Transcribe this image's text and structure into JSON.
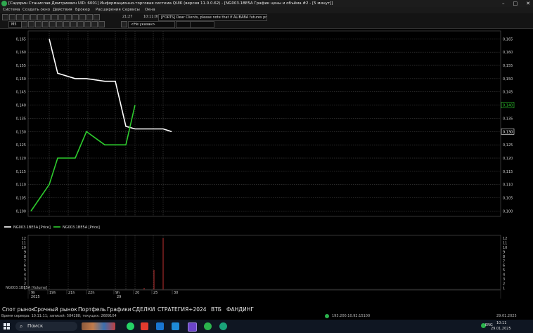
{
  "window": {
    "title": "[Садорин Станислав Дмитриевич UID: 6001] Информационно-торговая система QUIK (версия 11.0.0.62) - [NG003.1BE5A График цены и объёма #2 - [5 минут]]"
  },
  "menu": [
    "Система",
    "Создать окно",
    "Действия",
    "Брокер",
    "Расширения",
    "Сервисы",
    "Окна"
  ],
  "toolbar": {
    "interval": "М5",
    "time_a": "21:27",
    "time_b": "10:11:00",
    "news": "[FORTS] Dear Clients, please note that if ALIBABA futures price...",
    "account": "<Не указан>"
  },
  "chart_data": [
    {
      "type": "line",
      "x": [
        "18h",
        "19h",
        "20h",
        "21h",
        "22h",
        "23h",
        "9h",
        "10h",
        "20",
        "25",
        "30"
      ],
      "series": [
        {
          "name": "NG003.1BE5A [Price]",
          "color": "#ffffff",
          "values": [
            null,
            0.165,
            0.152,
            0.15,
            0.15,
            0.149,
            0.149,
            0.132,
            0.131,
            0.131,
            0.13
          ]
        },
        {
          "name": "NG003.1BE5A [Price]",
          "color": "#2ecc2e",
          "values": [
            0.1,
            0.11,
            0.12,
            0.12,
            0.13,
            0.125,
            0.125,
            0.125,
            0.14,
            null,
            null
          ]
        }
      ],
      "ylim": [
        0.098,
        0.168
      ],
      "yticks": [
        0.1,
        0.105,
        0.11,
        0.115,
        0.12,
        0.125,
        0.13,
        0.135,
        0.14,
        0.145,
        0.15,
        0.155,
        0.16,
        0.165
      ],
      "ytick_labels": [
        "0,100",
        "0,105",
        "0,110",
        "0,115",
        "0,120",
        "0,125",
        "0,130",
        "0,135",
        "0,140",
        "0,145",
        "0,150",
        "0,155",
        "0,160",
        "0,165"
      ],
      "last_values": [
        {
          "label": "0,130",
          "value": 0.13,
          "color": "#ffffff"
        },
        {
          "label": "0,140",
          "value": 0.14,
          "color": "#2ecc2e"
        }
      ],
      "grid": true
    },
    {
      "type": "bar",
      "series": [
        {
          "name": "NG003.1BE5A [Volume]",
          "color": "#c03030",
          "bars": [
            {
              "x": "20",
              "value": 1
            },
            {
              "x": "25",
              "value": 5
            },
            {
              "x": "30",
              "value": 12
            }
          ]
        }
      ],
      "ylim": [
        1,
        12
      ],
      "yticks": [
        1,
        2,
        3,
        4,
        5,
        6,
        7,
        8,
        9,
        10,
        11,
        12
      ]
    }
  ],
  "legend": {
    "price_white": "NG003.1BE5A [Price]",
    "price_green": "NG003.1BE5A [Price]",
    "volume": "NG003.1BE5A [Volume]"
  },
  "time_axis": {
    "row1": [
      "9h",
      "19h",
      "21h",
      "22h",
      "9h",
      "20",
      "25",
      "30"
    ],
    "year": "2025",
    "day": "29"
  },
  "bottom_tabs": [
    "Спот рынок",
    "Срочный рынок",
    "Портфель",
    "Графики",
    "СДЕЛКИ",
    "СТРАТЕГИЯ+2024",
    "ВТБ",
    "ФАНДИНГ"
  ],
  "status": {
    "server_time": "Время сервера: 10:11:11; записей: 584288; текущих: 2689104",
    "connection": "193.200.10.92:15100",
    "date": "29.01.2025"
  },
  "taskbar": {
    "search": "Поиск",
    "lang": "ENG",
    "clock_time": "10:11",
    "clock_date": "29.01.2025"
  }
}
